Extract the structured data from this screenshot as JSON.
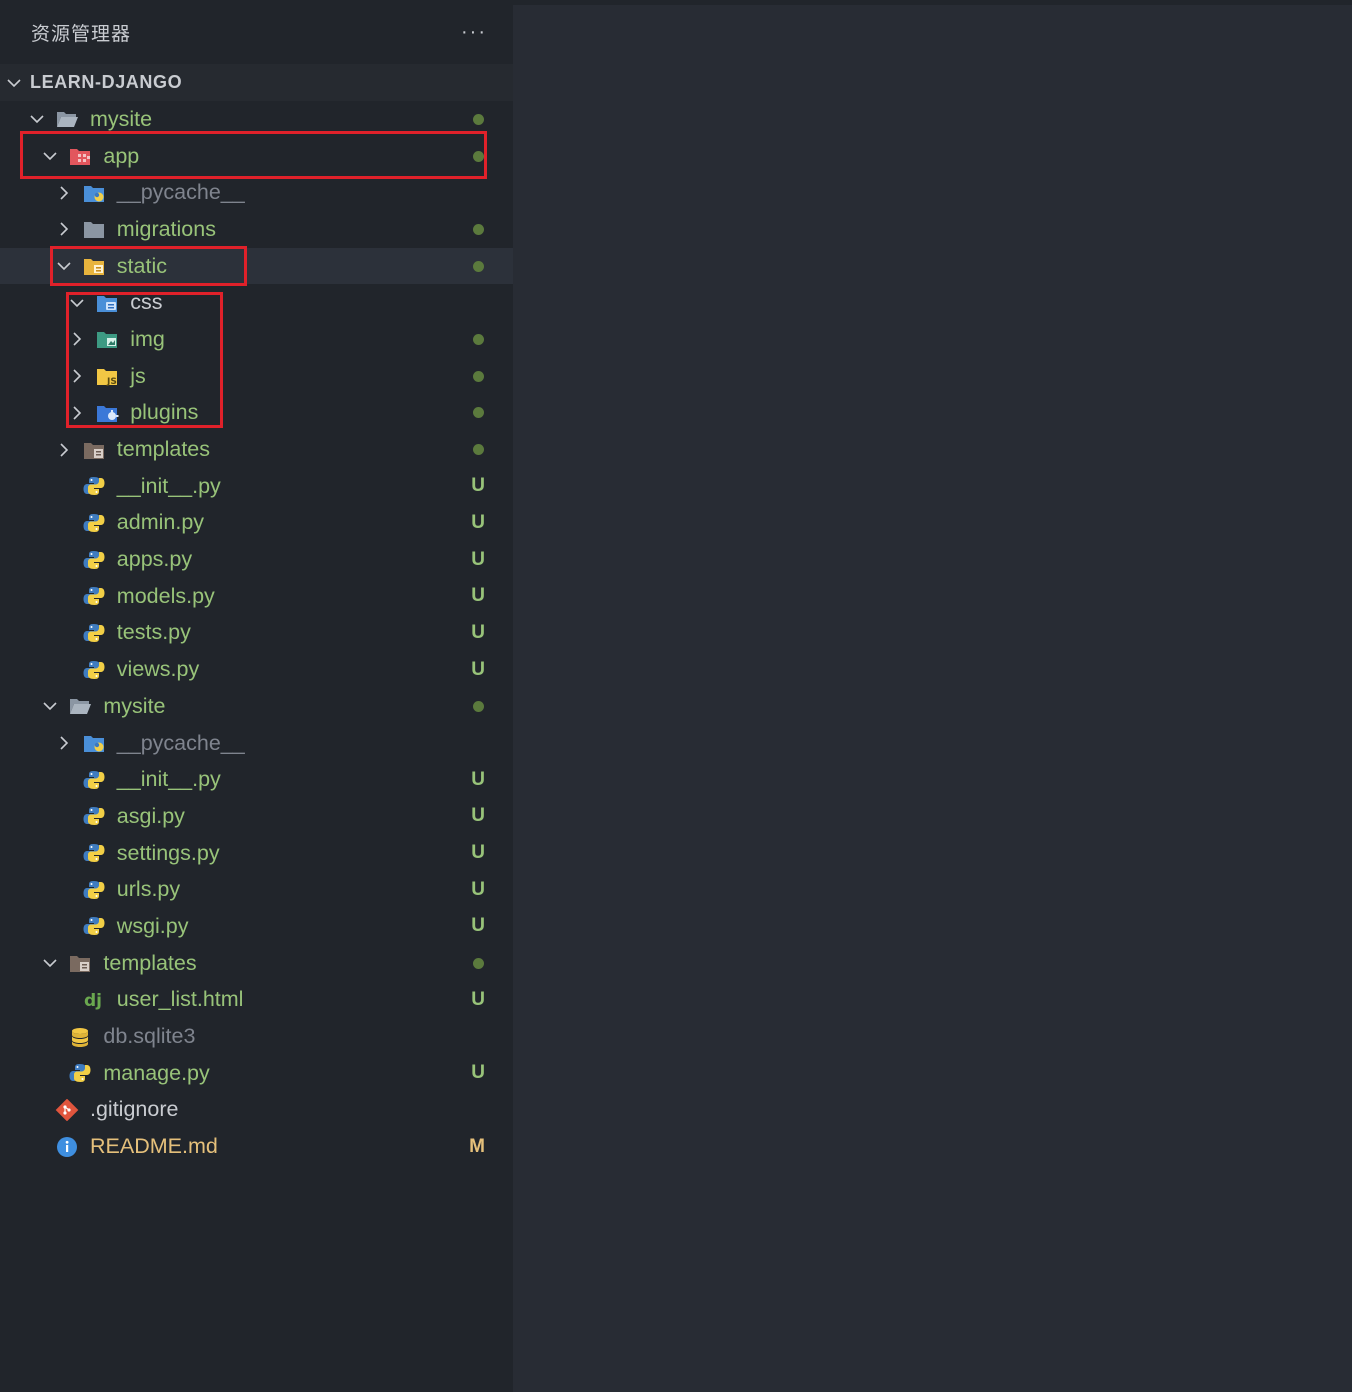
{
  "panel": {
    "title": "资源管理器",
    "more": "···"
  },
  "section": {
    "title": "LEARN-DJANGO"
  },
  "rows": [
    {
      "label": "mysite",
      "depth": 0,
      "chevron": "down",
      "icon": "folder-open-icon",
      "color": "green",
      "status": "dot"
    },
    {
      "label": "app",
      "depth": 1,
      "chevron": "down",
      "icon": "app-folder-icon",
      "color": "green",
      "status": "dot",
      "highlight": true
    },
    {
      "label": "__pycache__",
      "depth": 2,
      "chevron": "right",
      "icon": "pycache-folder-icon",
      "color": "gray",
      "status": ""
    },
    {
      "label": "migrations",
      "depth": 2,
      "chevron": "right",
      "icon": "folder-icon",
      "color": "green",
      "status": "dot"
    },
    {
      "label": "static",
      "depth": 2,
      "chevron": "down",
      "icon": "static-folder-icon",
      "color": "green",
      "status": "dot",
      "selected": true,
      "highlight": true
    },
    {
      "label": "css",
      "depth": 3,
      "chevron": "down",
      "icon": "css-folder-icon",
      "color": "white",
      "status": ""
    },
    {
      "label": "img",
      "depth": 3,
      "chevron": "right",
      "icon": "img-folder-icon",
      "color": "green",
      "status": "dot"
    },
    {
      "label": "js",
      "depth": 3,
      "chevron": "right",
      "icon": "js-folder-icon",
      "color": "green",
      "status": "dot"
    },
    {
      "label": "plugins",
      "depth": 3,
      "chevron": "right",
      "icon": "plugins-folder-icon",
      "color": "green",
      "status": "dot"
    },
    {
      "label": "templates",
      "depth": 2,
      "chevron": "right",
      "icon": "templates-folder-icon",
      "color": "green",
      "status": "dot"
    },
    {
      "label": "__init__.py",
      "depth": 2,
      "chevron": "",
      "icon": "python-icon",
      "color": "green",
      "status": "U"
    },
    {
      "label": "admin.py",
      "depth": 2,
      "chevron": "",
      "icon": "python-icon",
      "color": "green",
      "status": "U"
    },
    {
      "label": "apps.py",
      "depth": 2,
      "chevron": "",
      "icon": "python-icon",
      "color": "green",
      "status": "U"
    },
    {
      "label": "models.py",
      "depth": 2,
      "chevron": "",
      "icon": "python-icon",
      "color": "green",
      "status": "U"
    },
    {
      "label": "tests.py",
      "depth": 2,
      "chevron": "",
      "icon": "python-icon",
      "color": "green",
      "status": "U"
    },
    {
      "label": "views.py",
      "depth": 2,
      "chevron": "",
      "icon": "python-icon",
      "color": "green",
      "status": "U"
    },
    {
      "label": "mysite",
      "depth": 1,
      "chevron": "down",
      "icon": "folder-open-icon",
      "color": "green",
      "status": "dot"
    },
    {
      "label": "__pycache__",
      "depth": 2,
      "chevron": "right",
      "icon": "pycache-folder-icon",
      "color": "gray",
      "status": ""
    },
    {
      "label": "__init__.py",
      "depth": 2,
      "chevron": "",
      "icon": "python-icon",
      "color": "green",
      "status": "U"
    },
    {
      "label": "asgi.py",
      "depth": 2,
      "chevron": "",
      "icon": "python-icon",
      "color": "green",
      "status": "U"
    },
    {
      "label": "settings.py",
      "depth": 2,
      "chevron": "",
      "icon": "python-icon",
      "color": "green",
      "status": "U"
    },
    {
      "label": "urls.py",
      "depth": 2,
      "chevron": "",
      "icon": "python-icon",
      "color": "green",
      "status": "U"
    },
    {
      "label": "wsgi.py",
      "depth": 2,
      "chevron": "",
      "icon": "python-icon",
      "color": "green",
      "status": "U"
    },
    {
      "label": "templates",
      "depth": 1,
      "chevron": "down",
      "icon": "templates-folder-icon",
      "color": "green",
      "status": "dot"
    },
    {
      "label": "user_list.html",
      "depth": 2,
      "chevron": "",
      "icon": "django-icon",
      "color": "green",
      "status": "U"
    },
    {
      "label": "db.sqlite3",
      "depth": 1,
      "chevron": "",
      "icon": "database-icon",
      "color": "gray",
      "status": ""
    },
    {
      "label": "manage.py",
      "depth": 1,
      "chevron": "",
      "icon": "python-icon",
      "color": "green",
      "status": "U"
    },
    {
      "label": ".gitignore",
      "depth": 0,
      "chevron": "",
      "icon": "git-icon",
      "color": "white",
      "status": ""
    },
    {
      "label": "README.md",
      "depth": 0,
      "chevron": "",
      "icon": "info-icon",
      "color": "yellow",
      "status": "M"
    }
  ]
}
